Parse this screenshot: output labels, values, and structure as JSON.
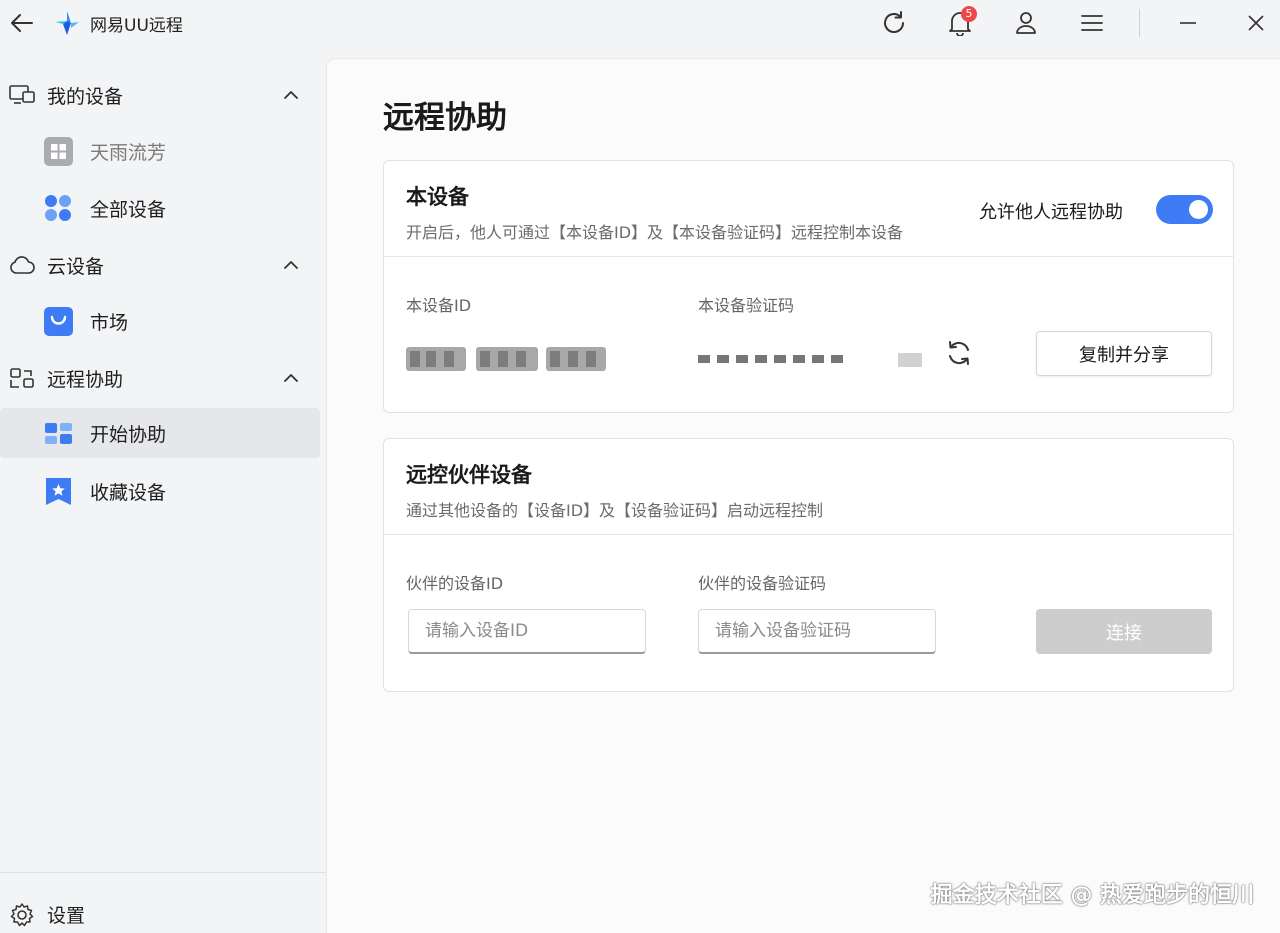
{
  "titlebar": {
    "app_name": "网易UU远程",
    "notification_count": "5"
  },
  "sidebar": {
    "groups": [
      {
        "label": "我的设备",
        "items": [
          {
            "label": "天雨流芳"
          },
          {
            "label": "全部设备"
          }
        ]
      },
      {
        "label": "云设备",
        "items": [
          {
            "label": "市场"
          }
        ]
      },
      {
        "label": "远程协助",
        "items": [
          {
            "label": "开始协助",
            "active": true
          },
          {
            "label": "收藏设备"
          }
        ]
      }
    ],
    "settings_label": "设置"
  },
  "main": {
    "page_title": "远程协助",
    "this_device": {
      "title": "本设备",
      "description": "开启后，他人可通过【本设备ID】及【本设备验证码】远程控制本设备",
      "toggle_label": "允许他人远程协助",
      "toggle_on": true,
      "id_label": "本设备ID",
      "code_label": "本设备验证码",
      "copy_share_label": "复制并分享"
    },
    "partner": {
      "title": "远控伙伴设备",
      "description": "通过其他设备的【设备ID】及【设备验证码】启动远程控制",
      "id_label": "伙伴的设备ID",
      "code_label": "伙伴的设备验证码",
      "id_placeholder": "请输入设备ID",
      "code_placeholder": "请输入设备验证码",
      "connect_label": "连接"
    }
  },
  "watermark": "掘金技术社区 @ 热爱跑步的恒川",
  "colors": {
    "accent": "#3d7cf4",
    "badge": "#f04848",
    "disabled_button": "#cdcdcd"
  }
}
